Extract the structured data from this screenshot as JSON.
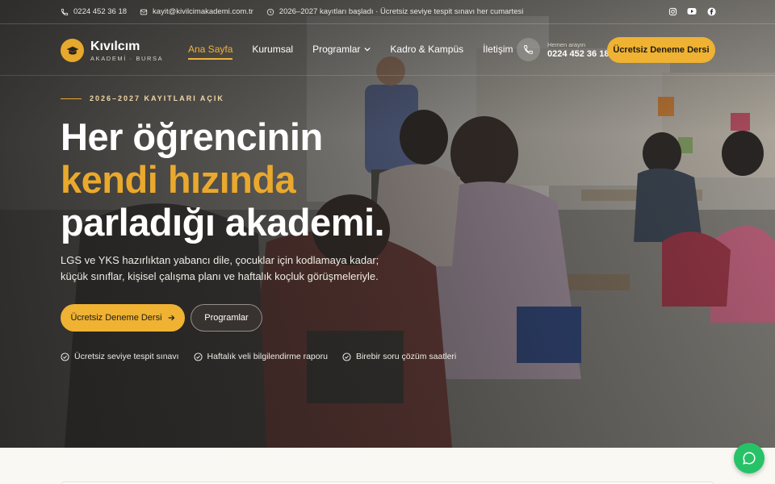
{
  "topbar": {
    "phone": "0224 452 36 18",
    "email": "kayit@kivilcimakademi.com.tr",
    "announcement": "2026–2027 kayıtları başladı · Ücretsiz seviye tespit sınavı her cumartesi",
    "socials": [
      {
        "icon": "instagram-icon"
      },
      {
        "icon": "youtube-icon"
      },
      {
        "icon": "facebook-icon"
      }
    ]
  },
  "brand": {
    "name": "Kıvılcım",
    "tagline": "AKADEMİ · BURSA",
    "logo_icon": "graduation-cap-icon"
  },
  "nav": {
    "items": [
      {
        "label": "Ana Sayfa",
        "active": true
      },
      {
        "label": "Kurumsal"
      },
      {
        "label": "Programlar",
        "has_dropdown": true
      },
      {
        "label": "Kadro & Kampüs"
      },
      {
        "label": "İletişim"
      }
    ],
    "phone_hint": "Hemen arayın",
    "phone_number": "0224 452 36 18",
    "cta_label": "Ücretsiz Deneme Dersi"
  },
  "hero": {
    "eyebrow": "2026–2027 KAYITLARI AÇIK",
    "headline_line1": "Her öğrencinin",
    "headline_line2": "kendi hızında",
    "headline_line3": "parladığı akademi.",
    "lead": "LGS ve YKS hazırlıktan yabancı dile, çocuklar için kodlamaya kadar; küçük sınıflar, kişisel çalışma planı ve haftalık koçluk görüşmeleriyle.",
    "primary_cta": "Ücretsiz Deneme Dersi",
    "secondary_cta": "Programlar",
    "features": [
      "Ücretsiz seviye tespit sınavı",
      "Haftalık veli bilgilendirme raporu",
      "Birebir soru çözüm saatleri"
    ]
  },
  "colors": {
    "accent": "#efb232",
    "headline_accent": "#eaa92d",
    "whatsapp": "#27c268"
  },
  "chat": {
    "icon": "whatsapp-icon"
  }
}
